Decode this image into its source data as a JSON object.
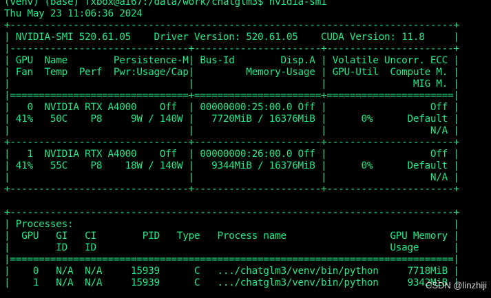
{
  "terminal": {
    "lines": [
      "(venv) (base) fxbox@ai67:/data/work/chatglm3$ nvidia-smi",
      "Thu May 23 11:06:36 2024",
      "+-----------------------------------------------------------------------------+",
      "| NVIDIA-SMI 520.61.05    Driver Version: 520.61.05    CUDA Version: 11.8     |",
      "|-------------------------------+----------------------+----------------------+",
      "| GPU  Name        Persistence-M| Bus-Id        Disp.A | Volatile Uncorr. ECC |",
      "| Fan  Temp  Perf  Pwr:Usage/Cap|         Memory-Usage | GPU-Util  Compute M. |",
      "|                               |                      |               MIG M. |",
      "|===============================+======================+======================|",
      "|   0  NVIDIA RTX A4000    Off  | 00000000:25:00.0 Off |                  Off |",
      "| 41%   50C    P8     9W / 140W |   7720MiB / 16376MiB |      0%      Default |",
      "|                               |                      |                  N/A |",
      "+-------------------------------+----------------------+----------------------+",
      "|   1  NVIDIA RTX A4000    Off  | 00000000:26:00.0 Off |                  Off |",
      "| 41%   55C    P8    18W / 140W |   9344MiB / 16376MiB |      0%      Default |",
      "|                               |                      |                  N/A |",
      "+-------------------------------+----------------------+----------------------+",
      "",
      "+-----------------------------------------------------------------------------+",
      "| Processes:                                                                  |",
      "|  GPU   GI   CI        PID   Type   Process name                  GPU Memory |",
      "|        ID   ID                                                   Usage      |",
      "|=============================================================================|",
      "|    0   N/A  N/A     15939      C   .../chatglm3/venv/bin/python     7718MiB |",
      "|    1   N/A  N/A     15939      C   .../chatglm3/venv/bin/python     9342MiB |"
    ]
  },
  "watermark": {
    "text": "CSDN @linzhiji"
  }
}
